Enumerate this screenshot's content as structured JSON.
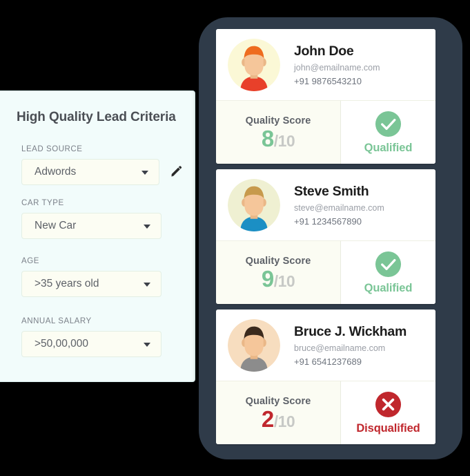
{
  "criteria_panel": {
    "title": "High Quality Lead Criteria",
    "edit_icon": "pencil-icon",
    "fields": [
      {
        "label": "LEAD SOURCE",
        "value": "Adwords",
        "caret": "chevron-down-icon",
        "has_edit": true
      },
      {
        "label": "CAR TYPE",
        "value": "New Car",
        "caret": "chevron-down-icon",
        "has_edit": false
      },
      {
        "label": "AGE",
        "value": ">35 years old",
        "caret": "chevron-down-icon",
        "has_edit": false
      },
      {
        "label": "ANNUAL SALARY",
        "value": ">50,00,000",
        "caret": "chevron-down-icon",
        "has_edit": false
      }
    ]
  },
  "phone": {
    "frame_color": "#2f3b49",
    "leads": [
      {
        "name": "John Doe",
        "email": "john@emailname.com",
        "phone": "+91 9876543210",
        "score_label": "Quality Score",
        "score": "8",
        "score_out_of": "/10",
        "score_color": "#7ac596",
        "status": "Qualified",
        "status_color": "#7ac596",
        "status_icon": "check-circle-icon",
        "avatar": {
          "name": "avatar-john-doe",
          "bg": "#fbf8d6",
          "hair": "#ee6c1f",
          "skin": "#f5c69a",
          "skin_shadow": "#eab787",
          "shirt": "#e8402a"
        }
      },
      {
        "name": "Steve Smith",
        "email": "steve@emailname.com",
        "phone": "+91 1234567890",
        "score_label": "Quality Score",
        "score": "9",
        "score_out_of": "/10",
        "score_color": "#7ac596",
        "status": "Qualified",
        "status_color": "#7ac596",
        "status_icon": "check-circle-icon",
        "avatar": {
          "name": "avatar-steve-smith",
          "bg": "#eff0d2",
          "hair": "#c79a4c",
          "skin": "#f5c69a",
          "skin_shadow": "#eab787",
          "shirt": "#1b8fc4"
        }
      },
      {
        "name": "Bruce J. Wickham",
        "email": "bruce@emailname.com",
        "phone": "+91 6541237689",
        "score_label": "Quality Score",
        "score": "2",
        "score_out_of": "/10",
        "score_color": "#c0272d",
        "status": "Disqualified",
        "status_color": "#c0272d",
        "status_icon": "x-circle-icon",
        "avatar": {
          "name": "avatar-bruce-wickham",
          "bg": "#f7ddbf",
          "hair": "#3b2a1d",
          "skin": "#f5c69a",
          "skin_shadow": "#eab787",
          "shirt": "#8c8c8c"
        }
      }
    ]
  }
}
